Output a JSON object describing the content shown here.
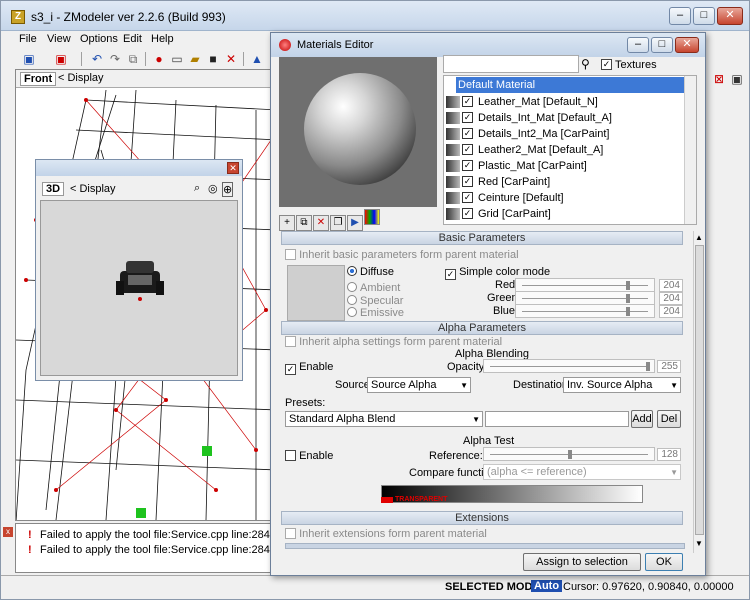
{
  "app": {
    "title": "s3_i - ZModeler ver 2.2.6 (Build 993)",
    "icon_glyph": "Z",
    "caption_min": "‒",
    "caption_max": "□",
    "caption_close": "✕"
  },
  "menu": [
    "File",
    "View",
    "Options",
    "Edit",
    "Help"
  ],
  "viewport": {
    "name": "Front",
    "display": "< Display"
  },
  "mini_view": {
    "name": "3D",
    "display": "< Display",
    "close": "✕"
  },
  "log": {
    "close": "x",
    "rows": [
      "Failed to apply the tool file:Service.cpp line:284",
      "Failed to apply the tool file:Service.cpp line:284"
    ]
  },
  "status": {
    "mode": "SELECTED MODE",
    "auto": "Auto",
    "cursor": "Cursor: 0.97620, 0.90840, 0.00000"
  },
  "materials_editor": {
    "title": "Materials Editor",
    "textures_label": "Textures",
    "textures_checked": true,
    "selected_material": "Default Material",
    "materials": [
      {
        "name": "Leather_Mat [Default_N]",
        "checked": true
      },
      {
        "name": "Details_Int_Mat [Default_A]",
        "checked": true
      },
      {
        "name": "Details_Int2_Ma [CarPaint]",
        "checked": true
      },
      {
        "name": "Leather2_Mat [Default_A]",
        "checked": true
      },
      {
        "name": "Plastic_Mat [CarPaint]",
        "checked": true
      },
      {
        "name": "Red [CarPaint]",
        "checked": true
      },
      {
        "name": "Ceinture [Default]",
        "checked": true
      },
      {
        "name": "Grid [CarPaint]",
        "checked": true
      }
    ],
    "basic": {
      "section_title": "Basic Parameters",
      "inherit_label": "Inherit basic parameters form parent material",
      "diffuse": "Diffuse",
      "ambient": "Ambient",
      "specular": "Specular",
      "emissive": "Emissive",
      "simple_color_mode": "Simple color mode",
      "red_label": "Red:",
      "green_label": "Green:",
      "blue_label": "Blue:",
      "red": "204",
      "green": "204",
      "blue": "204"
    },
    "alpha": {
      "section_title": "Alpha Parameters",
      "inherit_label": "Inherit alpha settings form parent material",
      "blending_title": "Alpha Blending",
      "enable_label": "Enable",
      "opacity_label": "Opacity:",
      "opacity": "255",
      "source_label": "Source:",
      "source_value": "Source Alpha",
      "destination_label": "Destination:",
      "destination_value": "Inv. Source Alpha",
      "presets_label": "Presets:",
      "preset_value": "Standard Alpha Blend",
      "add_button": "Add",
      "del_button": "Del",
      "test_title": "Alpha Test",
      "test_enable_label": "Enable",
      "reference_label": "Reference:",
      "reference": "128",
      "compare_label": "Compare function:",
      "compare_value": "(alpha <= reference)",
      "transparent_label": "TRANSPARENT"
    },
    "extensions": {
      "section_title": "Extensions",
      "inherit_label": "Inherit extensions form parent material"
    },
    "assign_button": "Assign to selection",
    "ok_button": "OK"
  }
}
